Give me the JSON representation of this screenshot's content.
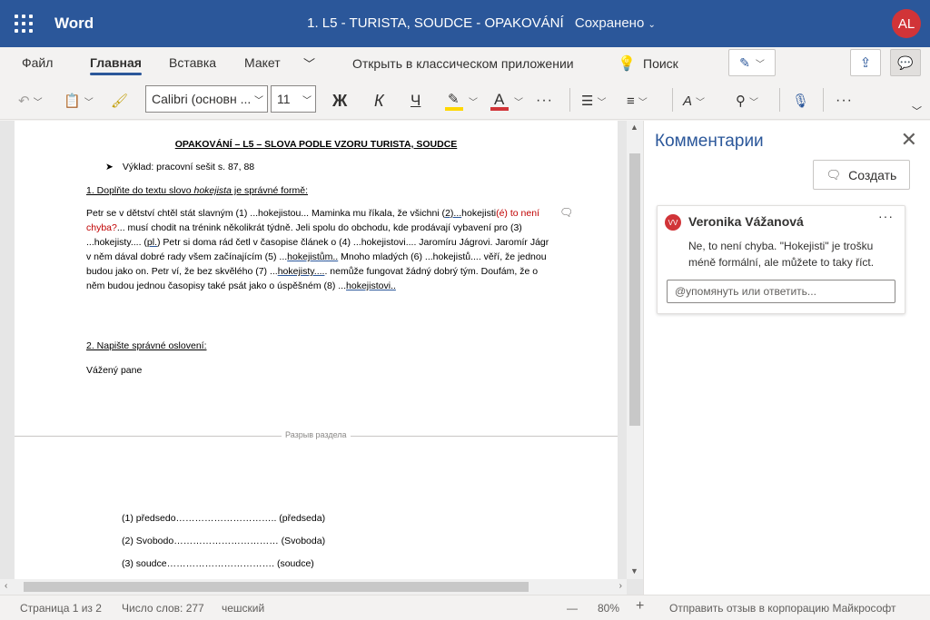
{
  "titlebar": {
    "app_name": "Word",
    "doc_title": "1. L5 - TURISTA, SOUDCE - OPAKOVÁNÍ",
    "saved_status": "Сохранено",
    "avatar_initials": "AL",
    "colors": {
      "bar": "#2b579a",
      "avatar": "#d13438"
    }
  },
  "ribbon": {
    "tabs": [
      "Файл",
      "Главная",
      "Вставка",
      "Макет"
    ],
    "active_tab": "Главная",
    "open_desktop": "Открыть в классическом приложении",
    "search_label": "Поиск",
    "font_name": "Calibri (основн ...",
    "font_size": "11",
    "bold": "Ж",
    "italic": "К",
    "underline": "Ч",
    "icons": [
      "undo-icon",
      "clipboard-icon",
      "format-painter-icon",
      "highlight-icon",
      "font-color-icon",
      "more-icon",
      "bullets-icon",
      "align-icon",
      "styles-icon",
      "find-icon",
      "dictate-icon",
      "edit-mode-icon",
      "share-icon",
      "comments-icon"
    ]
  },
  "document": {
    "title": "OPAKOVÁNÍ – L5 – SLOVA PODLE VZORU TURISTA, SOUDCE",
    "bullet": "Výklad: pracovní sešit s. 87, 88",
    "task1_prefix": "1. Doplňte do textu slovo ",
    "task1_word": "hokejista",
    "task1_suffix": " je správné formě:",
    "para": {
      "p1": "Petr se v dětství chtěl stát slavným (1) ...hokejistou... Maminka mu říkala, že všichni (",
      "p2": "2)...",
      "p3": "hokejisti",
      "p4_red": "(é) to není chyba?",
      "p5": "... musí chodit na trénink několikrát týdně. Jeli spolu do obchodu, kde prodávají vybavení pro (3) ...hokejisty.... (",
      "p6": "pl.",
      "p7": ") Petr si doma rád četl v časopise článek o (4) ...hokejistovi.... Jaromíru Jágrovi. Jaromír Jágr v něm dával dobré rady všem začínajícím (5) ...",
      "p8": "hokejistům..",
      "p9": " Mnoho mladých (6) ...hokejistů.... věří, že jednou budou jako on.  Petr ví, že bez skvělého (7) ...",
      "p10": "hokejisty....",
      "p11": ". nemůže fungovat žádný dobrý tým. Doufám, že o něm budou jednou časopisy také psát jako o úspěšném (8) ...",
      "p12": "hokejistovi.."
    },
    "task2": "2. Napište správné oslovení:",
    "vazeny": "Vážený pane",
    "section_break": "Разрыв раздела",
    "list": [
      "(1) předsedo………………………….. (předseda)",
      "(2) Svobodo…………………………… (Svoboda)",
      "(3) soudce……………………………. (soudce)"
    ]
  },
  "comments": {
    "title": "Комментарии",
    "new_button": "Создать",
    "card": {
      "initials": "VV",
      "author": "Veronika Vážanová",
      "body": "Ne, to není chyba. \"Hokejisti\" je trošku méně formální, ale můžete to taky říct.",
      "reply_placeholder": "@упомянуть или ответить..."
    }
  },
  "statusbar": {
    "page": "Страница 1 из 2",
    "words": "Число слов: 277",
    "language": "чешский",
    "zoom_minus": "—",
    "zoom": "80%",
    "zoom_plus": "+",
    "feedback": "Отправить отзыв в корпорацию Майкрософт"
  }
}
